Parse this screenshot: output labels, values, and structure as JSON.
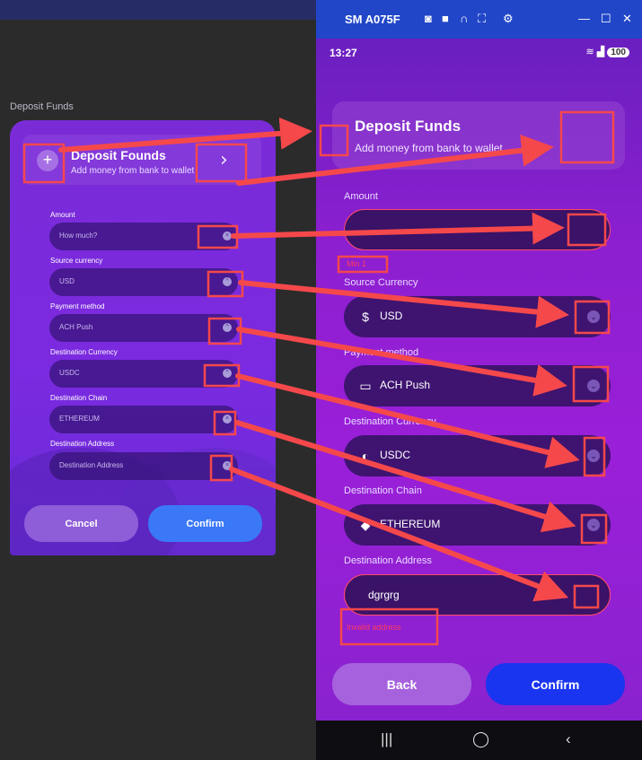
{
  "design_mockup": {
    "window_label": "Deposit Funds",
    "heading": "Deposit Founds",
    "subheading": "Add money from bank to wallet",
    "plus_glyph": "+",
    "chevron_glyph": "›",
    "fields": [
      {
        "label": "Amount",
        "value": "How much?"
      },
      {
        "label": "Source currency",
        "value": "USD"
      },
      {
        "label": "Payment method",
        "value": "ACH Push"
      },
      {
        "label": "Destination Currency",
        "value": "USDC"
      },
      {
        "label": "Destination Chain",
        "value": "ETHEREUM"
      },
      {
        "label": "Destination Address",
        "value": "Destination Address"
      }
    ],
    "cancel_label": "Cancel",
    "confirm_label": "Confirm"
  },
  "device": {
    "title": "SM A075F",
    "toolbar_icons": [
      "camera-icon",
      "video-icon",
      "headphones-icon",
      "fullscreen-icon",
      "settings-icon"
    ],
    "window_controls": [
      "minimize-icon",
      "maximize-icon",
      "close-icon"
    ],
    "status_time": "13:27",
    "battery": "100"
  },
  "app": {
    "heading": "Deposit Funds",
    "subheading": "Add money from bank to wallet",
    "amount": {
      "label": "Amount",
      "value": "",
      "error": "Min 1"
    },
    "source_currency": {
      "label": "Source Currency",
      "value": "USD",
      "icon": "dollar-icon"
    },
    "payment_method": {
      "label": "Payment method",
      "value": "ACH Push",
      "icon": "card-icon"
    },
    "destination_currency": {
      "label": "Destination Currency",
      "value": "USDC",
      "icon": "usdc-icon"
    },
    "destination_chain": {
      "label": "Destination Chain",
      "value": "ETHEREUM",
      "icon": "ethereum-icon"
    },
    "destination_address": {
      "label": "Destination Address",
      "value": "dgrgrg",
      "error": "Invalid address"
    },
    "back_label": "Back",
    "confirm_label": "Confirm"
  },
  "colors": {
    "annotation": "#f5484b",
    "accent_blue": "#1a35f0",
    "error_red": "#ff3b5c"
  }
}
